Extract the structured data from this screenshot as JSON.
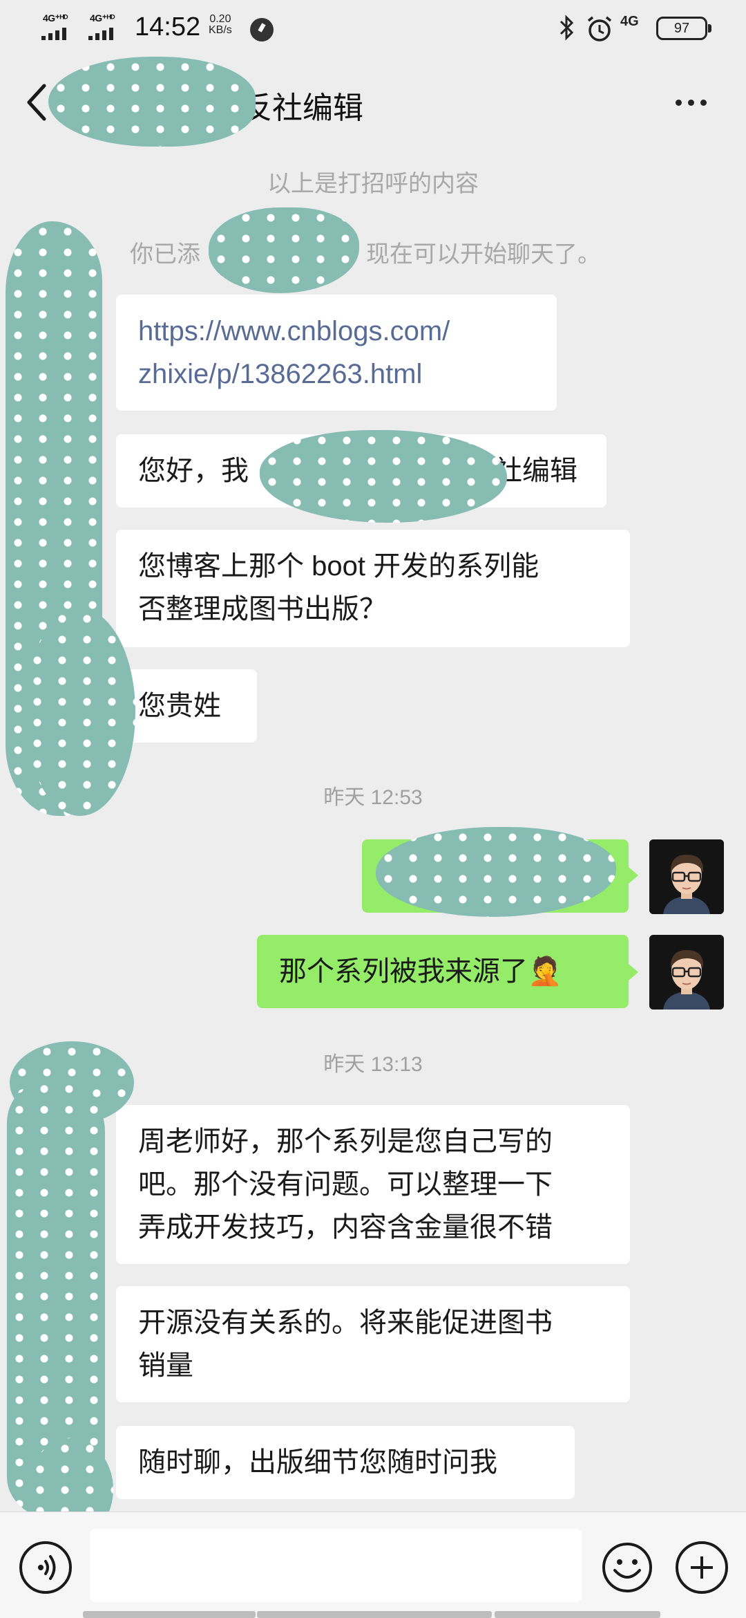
{
  "status_bar": {
    "signal_1": "4G⁺ᴴᴰ",
    "signal_2": "4G⁺ᴴᴰ",
    "time": "14:52",
    "speed_value": "0.20",
    "speed_unit": "KB/s",
    "network_label": "4G",
    "battery": "97"
  },
  "header": {
    "title_visible_suffix": "反社编辑"
  },
  "system": {
    "greeting_note": "以上是打招呼的内容",
    "added_prefix": "你已添",
    "added_suffix": "现在可以开始聊天了。"
  },
  "messages": [
    {
      "side": "in",
      "lines": [
        "https://www.cnblogs.com/",
        "zhixie/p/13862263.html"
      ]
    },
    {
      "side": "in",
      "lines": [
        "您好，我",
        "社编辑"
      ]
    },
    {
      "side": "in",
      "lines": [
        "您博客上那个 boot 开发的系列能",
        "否整理成图书出版？"
      ]
    },
    {
      "side": "in",
      "lines": [
        "您贵姓"
      ]
    },
    {
      "side": "out",
      "lines": [
        ""
      ]
    },
    {
      "side": "out",
      "lines": [
        "那个系列被我来源了🤦"
      ]
    },
    {
      "side": "in",
      "lines": [
        "周老师好，那个系列是您自己写的",
        "吧。那个没有问题。可以整理一下",
        "弄成开发技巧，内容含金量很不错"
      ]
    },
    {
      "side": "in",
      "lines": [
        "开源没有关系的。将来能促进图书",
        "销量"
      ]
    },
    {
      "side": "in",
      "lines": [
        "随时聊，出版细节您随时问我"
      ]
    }
  ],
  "timestamps": [
    "昨天 12:53",
    "昨天 13:13"
  ],
  "input": {
    "placeholder": ""
  },
  "icons": {
    "back": "chevron-left-icon",
    "more": "more-dots-icon",
    "voice": "voice-icon",
    "emoji": "emoji-icon",
    "plus": "plus-icon"
  },
  "colors": {
    "background": "#ededed",
    "bubble_in": "#ffffff",
    "bubble_out": "#95ec69",
    "link": "#576b95",
    "mask": "#86bcb1"
  }
}
